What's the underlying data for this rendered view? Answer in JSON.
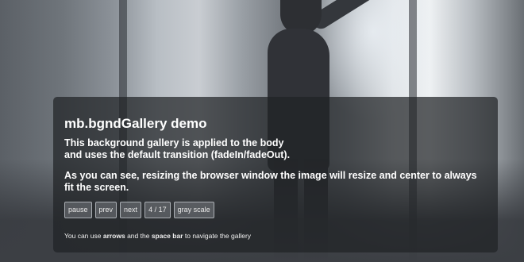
{
  "demo": {
    "title": "mb.bgndGallery demo",
    "intro_line1": "This background gallery is applied to the body",
    "intro_line2": "and uses the default transition (fadeIn/fadeOut).",
    "resize_line1": "As you can see, resizing the browser window the image will resize and center to always",
    "resize_line2": "fit the screen."
  },
  "controls": {
    "pause_label": "pause",
    "prev_label": "prev",
    "next_label": "next",
    "counter_label": "4 / 17",
    "grayscale_label": "gray scale"
  },
  "help": {
    "prefix": "You can use ",
    "arrows": "arrows",
    "middle": " and the ",
    "space_bar": "space bar",
    "suffix": " to navigate the gallery"
  },
  "colors": {
    "panel_background": "#202226",
    "text": "#ffffff"
  }
}
